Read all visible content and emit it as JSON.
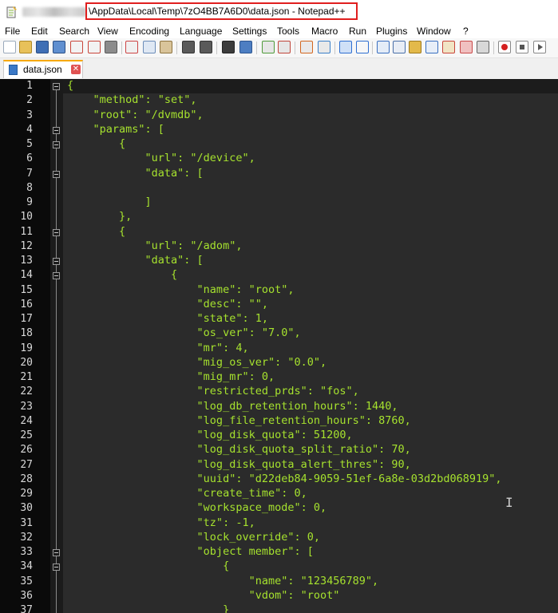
{
  "window": {
    "title": "\\AppData\\Local\\Temp\\7zO4BB7A6D0\\data.json - Notepad++"
  },
  "menu": [
    "File",
    "Edit",
    "Search",
    "View",
    "Encoding",
    "Language",
    "Settings",
    "Tools",
    "Macro",
    "Run",
    "Plugins",
    "Window",
    "?"
  ],
  "toolbar": {
    "icons": [
      "new-file-icon",
      "open-file-icon",
      "save-icon",
      "save-all-icon",
      "close-icon",
      "close-all-icon",
      "print-icon",
      "cut-icon",
      "copy-icon",
      "paste-icon",
      "undo-icon",
      "redo-icon",
      "find-icon",
      "replace-icon",
      "zoom-in-icon",
      "zoom-out-icon",
      "sync-vertical-icon",
      "sync-horizontal-icon",
      "word-wrap-icon",
      "show-all-characters-icon",
      "indent-guide-icon",
      "language-icon",
      "document-map-icon",
      "function-list-icon",
      "folder-as-workspace-icon",
      "monitoring-icon",
      "record-macro-icon",
      "stop-macro-icon",
      "play-macro-icon"
    ]
  },
  "tab": {
    "label": "data.json"
  },
  "editor": {
    "lines": [
      "{",
      "    \"method\": \"set\",",
      "    \"root\": \"/dvmdb\",",
      "    \"params\": [",
      "        {",
      "            \"url\": \"/device\",",
      "            \"data\": [",
      "",
      "            ]",
      "        },",
      "        {",
      "            \"url\": \"/adom\",",
      "            \"data\": [",
      "                {",
      "                    \"name\": \"root\",",
      "                    \"desc\": \"\",",
      "                    \"state\": 1,",
      "                    \"os_ver\": \"7.0\",",
      "                    \"mr\": 4,",
      "                    \"mig_os_ver\": \"0.0\",",
      "                    \"mig_mr\": 0,",
      "                    \"restricted_prds\": \"fos\",",
      "                    \"log_db_retention_hours\": 1440,",
      "                    \"log_file_retention_hours\": 8760,",
      "                    \"log_disk_quota\": 51200,",
      "                    \"log_disk_quota_split_ratio\": 70,",
      "                    \"log_disk_quota_alert_thres\": 90,",
      "                    \"uuid\": \"d22deb84-9059-51ef-6a8e-03d2bd068919\",",
      "                    \"create_time\": 0,",
      "                    \"workspace_mode\": 0,",
      "                    \"tz\": -1,",
      "                    \"lock_override\": 0,",
      "                    \"object member\": [",
      "                        {",
      "                            \"name\": \"123456789\",",
      "                            \"vdom\": \"root\"",
      "                        }"
    ],
    "fold_lines": [
      1,
      4,
      5,
      7,
      11,
      13,
      14,
      33,
      34
    ],
    "colors": {
      "background": "#2b2b2b",
      "text": "#a6e22e",
      "line_number": "#d8d8d8"
    }
  }
}
